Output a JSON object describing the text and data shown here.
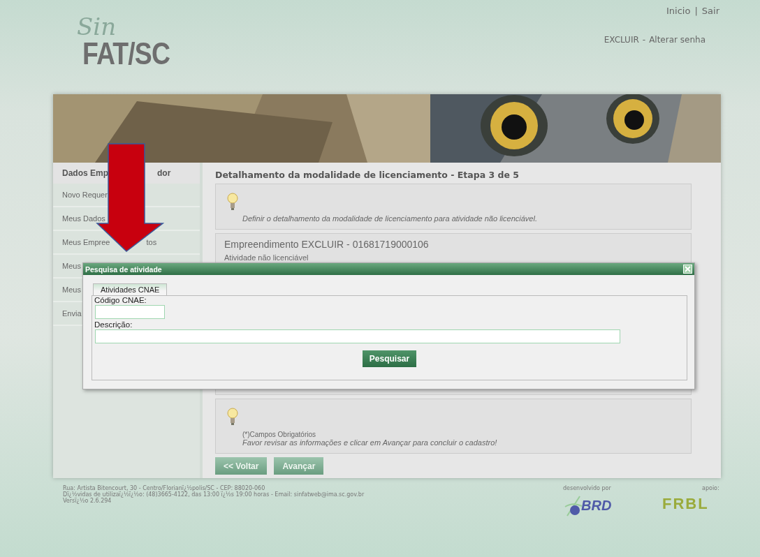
{
  "header": {
    "logo_script": "Sin",
    "logo_text": "FAT/SC",
    "links": [
      {
        "label": "Inicio"
      },
      {
        "label": "Sair"
      }
    ],
    "separator": "|",
    "user": "EXCLUIR",
    "user_separator": "-",
    "account_link": "Alterar senha"
  },
  "sidebar": {
    "title_parts": [
      "Dados Emp",
      "dor"
    ],
    "items": [
      {
        "parts": [
          "Novo Requer"
        ]
      },
      {
        "parts": [
          "Meus Dados"
        ]
      },
      {
        "parts": [
          "Meus Empree",
          "tos"
        ]
      },
      {
        "parts": [
          "Meus"
        ]
      },
      {
        "parts": [
          "Meus"
        ]
      },
      {
        "parts": [
          "Envia"
        ]
      }
    ]
  },
  "content": {
    "heading": "Detalhamento da modalidade de licenciamento - Etapa 3 de 5",
    "hint": "Definir o detalhamento da modalidade de licenciamento para atividade não licenciável.",
    "enterprise": "Empreendimento EXCLUIR - 01681719000106",
    "activity_label": "Atividade não licenciável",
    "required_note": "(*)Campos Obrigatórios",
    "review_hint": "Favor revisar as informações e clicar em Avançar para concluir o cadastro!",
    "buttons": [
      "<< Voltar",
      "Avançar"
    ]
  },
  "dialog": {
    "title": "Pesquisa de atividade",
    "tabs": [
      {
        "label": "Atividades CNAE",
        "selected": true
      }
    ],
    "fields": [
      {
        "label": "Código CNAE:",
        "kind": "short"
      },
      {
        "label": "Descrição:",
        "kind": "wide"
      }
    ],
    "button": "Pesquisar"
  },
  "footer": {
    "lines": [
      "Rua: Artista Bitencourt, 30 - Centro/Florianï¿½polis/SC - CEP: 88020-060",
      "Dï¿½vidas de utilizaï¿½ï¿½o: (48)3665-4122, das 13:00 ï¿½s 19:00 horas - Email: sinfatweb@ima.sc.gov.br",
      "Versï¿½o 2.6.294"
    ],
    "developer_label": "desenvolvido por",
    "developer_logo": "BRD",
    "support_label": "apoio:",
    "support_logo": "FRBL"
  }
}
